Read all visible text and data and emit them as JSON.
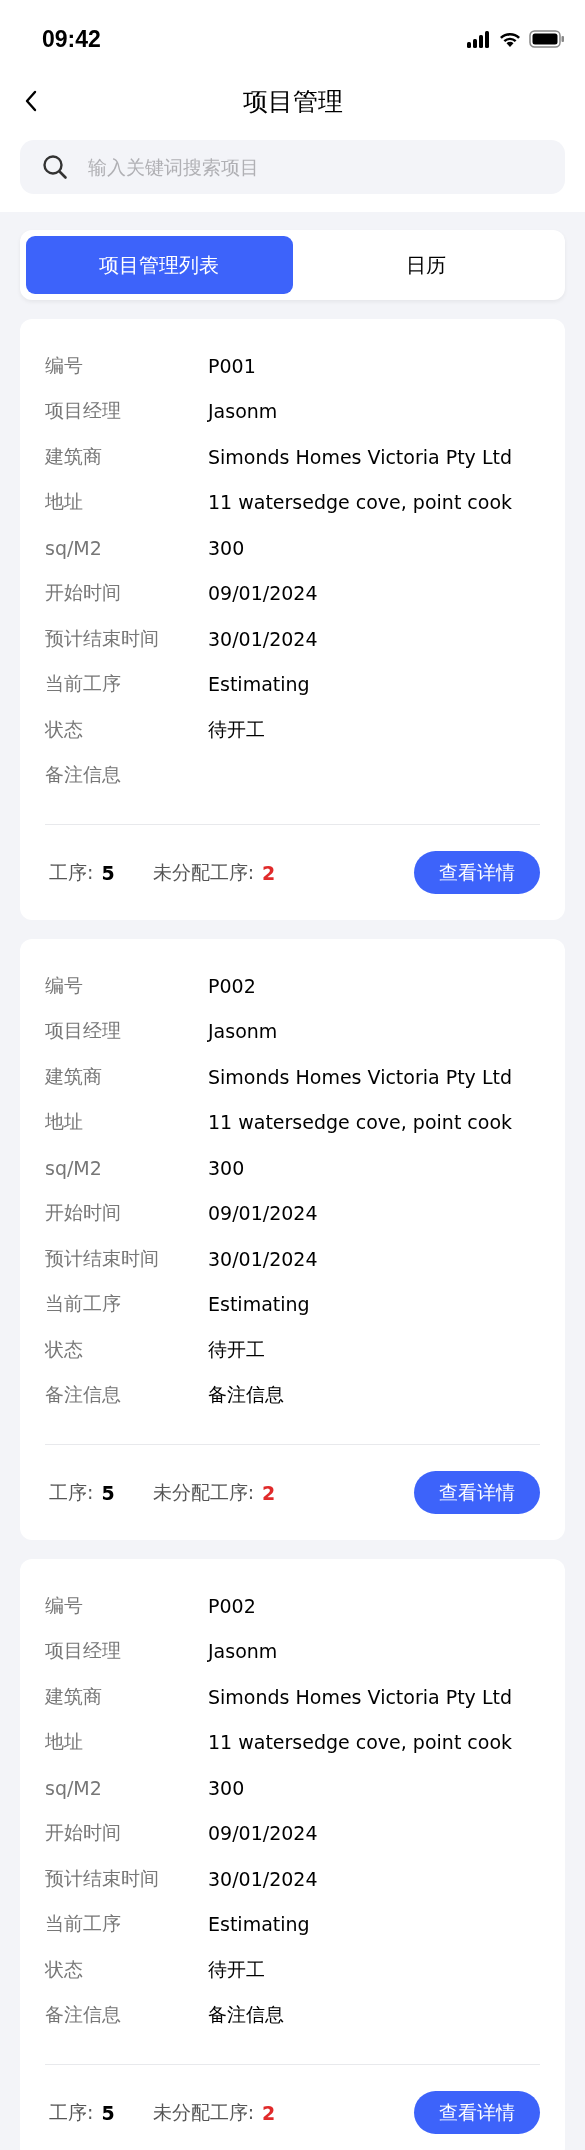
{
  "status_bar": {
    "time": "09:42"
  },
  "header": {
    "title": "项目管理"
  },
  "search": {
    "placeholder": "输入关键词搜索项目"
  },
  "tabs": [
    {
      "label": "项目管理列表",
      "selected": true
    },
    {
      "label": "日历",
      "selected": false
    }
  ],
  "projects": [
    {
      "fields": [
        {
          "label": "编号",
          "value": "P001"
        },
        {
          "label": "项目经理",
          "value": "Jasonm"
        },
        {
          "label": "建筑商",
          "value": "Simonds Homes Victoria Pty Ltd"
        },
        {
          "label": "地址",
          "value": "11 watersedge cove, point cook"
        },
        {
          "label": "sq/M2",
          "value": "300"
        },
        {
          "label": "开始时间",
          "value": "09/01/2024"
        },
        {
          "label": "预计结束时间",
          "value": "30/01/2024"
        },
        {
          "label": "当前工序",
          "value": "Estimating"
        },
        {
          "label": "状态",
          "value": "待开工"
        },
        {
          "label": "备注信息"
        }
      ],
      "steps_label": "工序:",
      "steps": "5",
      "unassigned_label": "未分配工序:",
      "unassigned": "2",
      "button": "查看详情"
    },
    {
      "fields": [
        {
          "label": "编号",
          "value": "P002"
        },
        {
          "label": "项目经理",
          "value": "Jasonm"
        },
        {
          "label": "建筑商",
          "value": "Simonds Homes Victoria Pty Ltd"
        },
        {
          "label": "地址",
          "value": "11 watersedge cove, point cook"
        },
        {
          "label": "sq/M2",
          "value": "300"
        },
        {
          "label": "开始时间",
          "value": "09/01/2024"
        },
        {
          "label": "预计结束时间",
          "value": "30/01/2024"
        },
        {
          "label": "当前工序",
          "value": "Estimating"
        },
        {
          "label": "状态",
          "value": "待开工"
        },
        {
          "label": "备注信息",
          "value": "备注信息"
        }
      ],
      "steps_label": "工序:",
      "steps": "5",
      "unassigned_label": "未分配工序:",
      "unassigned": "2",
      "button": "查看详情"
    },
    {
      "fields": [
        {
          "label": "编号",
          "value": "P002"
        },
        {
          "label": "项目经理",
          "value": "Jasonm"
        },
        {
          "label": "建筑商",
          "value": "Simonds Homes Victoria Pty Ltd"
        },
        {
          "label": "地址",
          "value": "11 watersedge cove, point cook"
        },
        {
          "label": "sq/M2",
          "value": "300"
        },
        {
          "label": "开始时间",
          "value": "09/01/2024"
        },
        {
          "label": "预计结束时间",
          "value": "30/01/2024"
        },
        {
          "label": "当前工序",
          "value": "Estimating"
        },
        {
          "label": "状态",
          "value": "待开工"
        },
        {
          "label": "备注信息",
          "value": "备注信息"
        }
      ],
      "steps_label": "工序:",
      "steps": "5",
      "unassigned_label": "未分配工序:",
      "unassigned": "2",
      "button": "查看详情"
    }
  ]
}
